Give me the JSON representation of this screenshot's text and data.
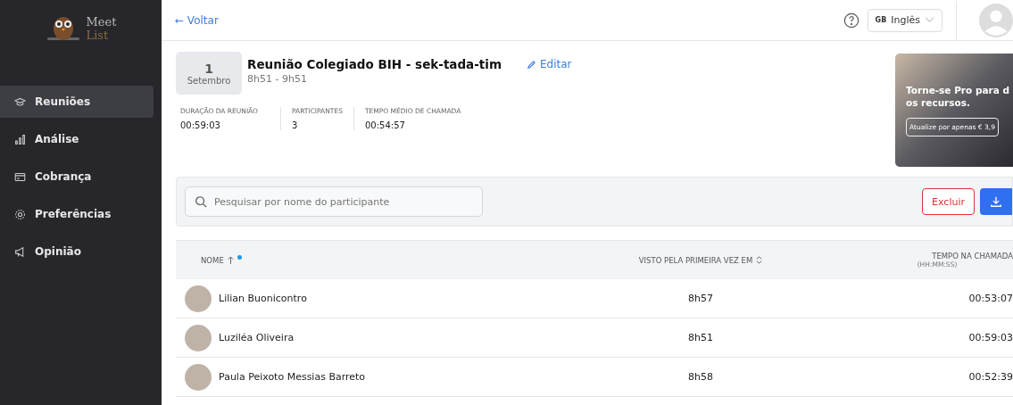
{
  "logo": {
    "line1": "Meet",
    "line2": "List"
  },
  "sidebar": {
    "items": [
      {
        "label": "Reuniões",
        "selected": true
      },
      {
        "label": "Análise",
        "selected": false
      },
      {
        "label": "Cobrança",
        "selected": false
      },
      {
        "label": "Preferências",
        "selected": false
      },
      {
        "label": "Opinião",
        "selected": false
      }
    ]
  },
  "header": {
    "back": "← Voltar",
    "language": {
      "flag": "GB",
      "label": "Inglês"
    }
  },
  "meeting": {
    "day": "1",
    "month": "Setembro",
    "title": "Reunião Colegiado BIH - sek-tada-tim",
    "time": "8h51 - 9h51",
    "edit": "Editar",
    "stats": [
      {
        "label": "DURAÇÃO DA REUNIÃO",
        "value": "00:59:03"
      },
      {
        "label": "PARTICIPANTES",
        "value": "3"
      },
      {
        "label": "TEMPO MÉDIO DE CHAMADA",
        "value": "00:54:57"
      }
    ]
  },
  "promo": {
    "title_line1": "Torne-se Pro para d",
    "title_line2": "os recursos.",
    "button": "Atualize por apenas € 3,9"
  },
  "search": {
    "placeholder": "Pesquisar por nome do participante"
  },
  "actions": {
    "delete": "Excluir"
  },
  "table": {
    "columns": [
      {
        "label": "NOME"
      },
      {
        "label": "VISTO PELA PRIMEIRA VEZ EM"
      },
      {
        "label": "TEMPO NA CHAMADA",
        "sub": "(HH:MM:SS)"
      }
    ],
    "rows": [
      {
        "name": "Lilian Buonicontro",
        "first_seen": "8h57",
        "duration": "00:53:07"
      },
      {
        "name": "Luziléa Oliveira",
        "first_seen": "8h51",
        "duration": "00:59:03"
      },
      {
        "name": "Paula Peixoto Messias Barreto",
        "first_seen": "8h58",
        "duration": "00:52:39"
      }
    ]
  }
}
